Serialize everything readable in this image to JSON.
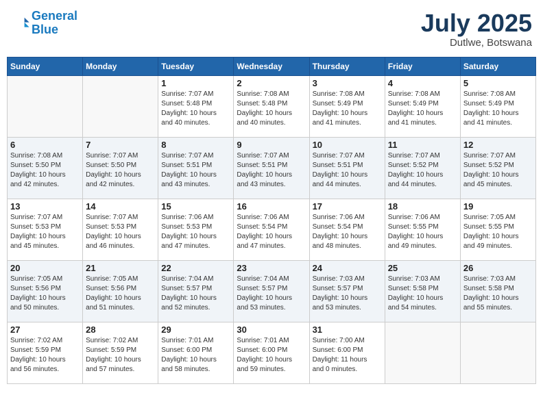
{
  "header": {
    "logo_line1": "General",
    "logo_line2": "Blue",
    "month": "July 2025",
    "location": "Dutlwe, Botswana"
  },
  "weekdays": [
    "Sunday",
    "Monday",
    "Tuesday",
    "Wednesday",
    "Thursday",
    "Friday",
    "Saturday"
  ],
  "weeks": [
    [
      {
        "day": "",
        "info": ""
      },
      {
        "day": "",
        "info": ""
      },
      {
        "day": "1",
        "info": "Sunrise: 7:07 AM\nSunset: 5:48 PM\nDaylight: 10 hours\nand 40 minutes."
      },
      {
        "day": "2",
        "info": "Sunrise: 7:08 AM\nSunset: 5:48 PM\nDaylight: 10 hours\nand 40 minutes."
      },
      {
        "day": "3",
        "info": "Sunrise: 7:08 AM\nSunset: 5:49 PM\nDaylight: 10 hours\nand 41 minutes."
      },
      {
        "day": "4",
        "info": "Sunrise: 7:08 AM\nSunset: 5:49 PM\nDaylight: 10 hours\nand 41 minutes."
      },
      {
        "day": "5",
        "info": "Sunrise: 7:08 AM\nSunset: 5:49 PM\nDaylight: 10 hours\nand 41 minutes."
      }
    ],
    [
      {
        "day": "6",
        "info": "Sunrise: 7:08 AM\nSunset: 5:50 PM\nDaylight: 10 hours\nand 42 minutes."
      },
      {
        "day": "7",
        "info": "Sunrise: 7:07 AM\nSunset: 5:50 PM\nDaylight: 10 hours\nand 42 minutes."
      },
      {
        "day": "8",
        "info": "Sunrise: 7:07 AM\nSunset: 5:51 PM\nDaylight: 10 hours\nand 43 minutes."
      },
      {
        "day": "9",
        "info": "Sunrise: 7:07 AM\nSunset: 5:51 PM\nDaylight: 10 hours\nand 43 minutes."
      },
      {
        "day": "10",
        "info": "Sunrise: 7:07 AM\nSunset: 5:51 PM\nDaylight: 10 hours\nand 44 minutes."
      },
      {
        "day": "11",
        "info": "Sunrise: 7:07 AM\nSunset: 5:52 PM\nDaylight: 10 hours\nand 44 minutes."
      },
      {
        "day": "12",
        "info": "Sunrise: 7:07 AM\nSunset: 5:52 PM\nDaylight: 10 hours\nand 45 minutes."
      }
    ],
    [
      {
        "day": "13",
        "info": "Sunrise: 7:07 AM\nSunset: 5:53 PM\nDaylight: 10 hours\nand 45 minutes."
      },
      {
        "day": "14",
        "info": "Sunrise: 7:07 AM\nSunset: 5:53 PM\nDaylight: 10 hours\nand 46 minutes."
      },
      {
        "day": "15",
        "info": "Sunrise: 7:06 AM\nSunset: 5:53 PM\nDaylight: 10 hours\nand 47 minutes."
      },
      {
        "day": "16",
        "info": "Sunrise: 7:06 AM\nSunset: 5:54 PM\nDaylight: 10 hours\nand 47 minutes."
      },
      {
        "day": "17",
        "info": "Sunrise: 7:06 AM\nSunset: 5:54 PM\nDaylight: 10 hours\nand 48 minutes."
      },
      {
        "day": "18",
        "info": "Sunrise: 7:06 AM\nSunset: 5:55 PM\nDaylight: 10 hours\nand 49 minutes."
      },
      {
        "day": "19",
        "info": "Sunrise: 7:05 AM\nSunset: 5:55 PM\nDaylight: 10 hours\nand 49 minutes."
      }
    ],
    [
      {
        "day": "20",
        "info": "Sunrise: 7:05 AM\nSunset: 5:56 PM\nDaylight: 10 hours\nand 50 minutes."
      },
      {
        "day": "21",
        "info": "Sunrise: 7:05 AM\nSunset: 5:56 PM\nDaylight: 10 hours\nand 51 minutes."
      },
      {
        "day": "22",
        "info": "Sunrise: 7:04 AM\nSunset: 5:57 PM\nDaylight: 10 hours\nand 52 minutes."
      },
      {
        "day": "23",
        "info": "Sunrise: 7:04 AM\nSunset: 5:57 PM\nDaylight: 10 hours\nand 53 minutes."
      },
      {
        "day": "24",
        "info": "Sunrise: 7:03 AM\nSunset: 5:57 PM\nDaylight: 10 hours\nand 53 minutes."
      },
      {
        "day": "25",
        "info": "Sunrise: 7:03 AM\nSunset: 5:58 PM\nDaylight: 10 hours\nand 54 minutes."
      },
      {
        "day": "26",
        "info": "Sunrise: 7:03 AM\nSunset: 5:58 PM\nDaylight: 10 hours\nand 55 minutes."
      }
    ],
    [
      {
        "day": "27",
        "info": "Sunrise: 7:02 AM\nSunset: 5:59 PM\nDaylight: 10 hours\nand 56 minutes."
      },
      {
        "day": "28",
        "info": "Sunrise: 7:02 AM\nSunset: 5:59 PM\nDaylight: 10 hours\nand 57 minutes."
      },
      {
        "day": "29",
        "info": "Sunrise: 7:01 AM\nSunset: 6:00 PM\nDaylight: 10 hours\nand 58 minutes."
      },
      {
        "day": "30",
        "info": "Sunrise: 7:01 AM\nSunset: 6:00 PM\nDaylight: 10 hours\nand 59 minutes."
      },
      {
        "day": "31",
        "info": "Sunrise: 7:00 AM\nSunset: 6:00 PM\nDaylight: 11 hours\nand 0 minutes."
      },
      {
        "day": "",
        "info": ""
      },
      {
        "day": "",
        "info": ""
      }
    ]
  ]
}
